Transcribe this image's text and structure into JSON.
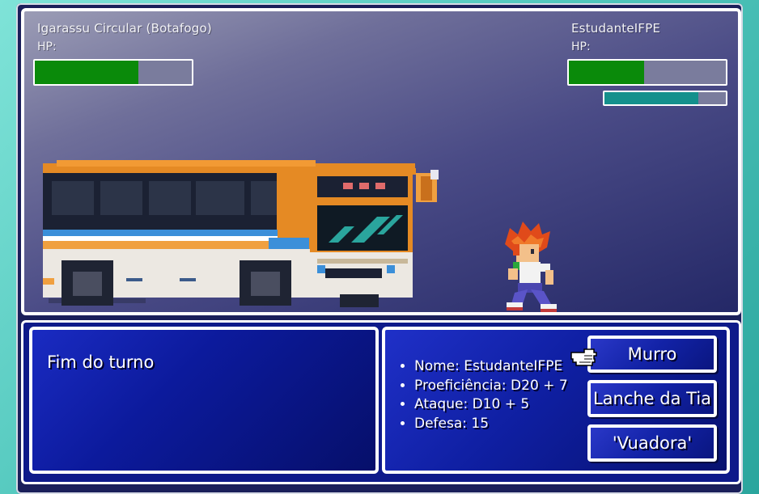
{
  "enemy": {
    "name": "Igarassu Circular (Botafogo)",
    "hp_label": "HP:",
    "hp_fraction": 0.66
  },
  "player": {
    "name": "EstudanteIFPE",
    "hp_label": "HP:",
    "hp_fraction": 0.48,
    "secondary_fraction": 0.77
  },
  "message": {
    "text": "Fim do turno"
  },
  "stats": [
    {
      "text": "Nome: EstudanteIFPE"
    },
    {
      "text": "Proeficiência: D20 + 7"
    },
    {
      "text": "Ataque: D10 + 5"
    },
    {
      "text": "Defesa: 15"
    }
  ],
  "actions": [
    {
      "label": "Murro"
    },
    {
      "label": "Lanche da Tia"
    },
    {
      "label": "'Vuadora'"
    }
  ],
  "colors": {
    "hp_fill": "#0a8a0a",
    "secondary_fill": "#14908c",
    "hp_empty": "#7a7c9d",
    "panel_blue": "#0e1a8a"
  },
  "icons": {
    "cursor": "pointing-hand-icon",
    "enemy_sprite": "bus-sprite",
    "player_sprite": "student-sprite"
  }
}
